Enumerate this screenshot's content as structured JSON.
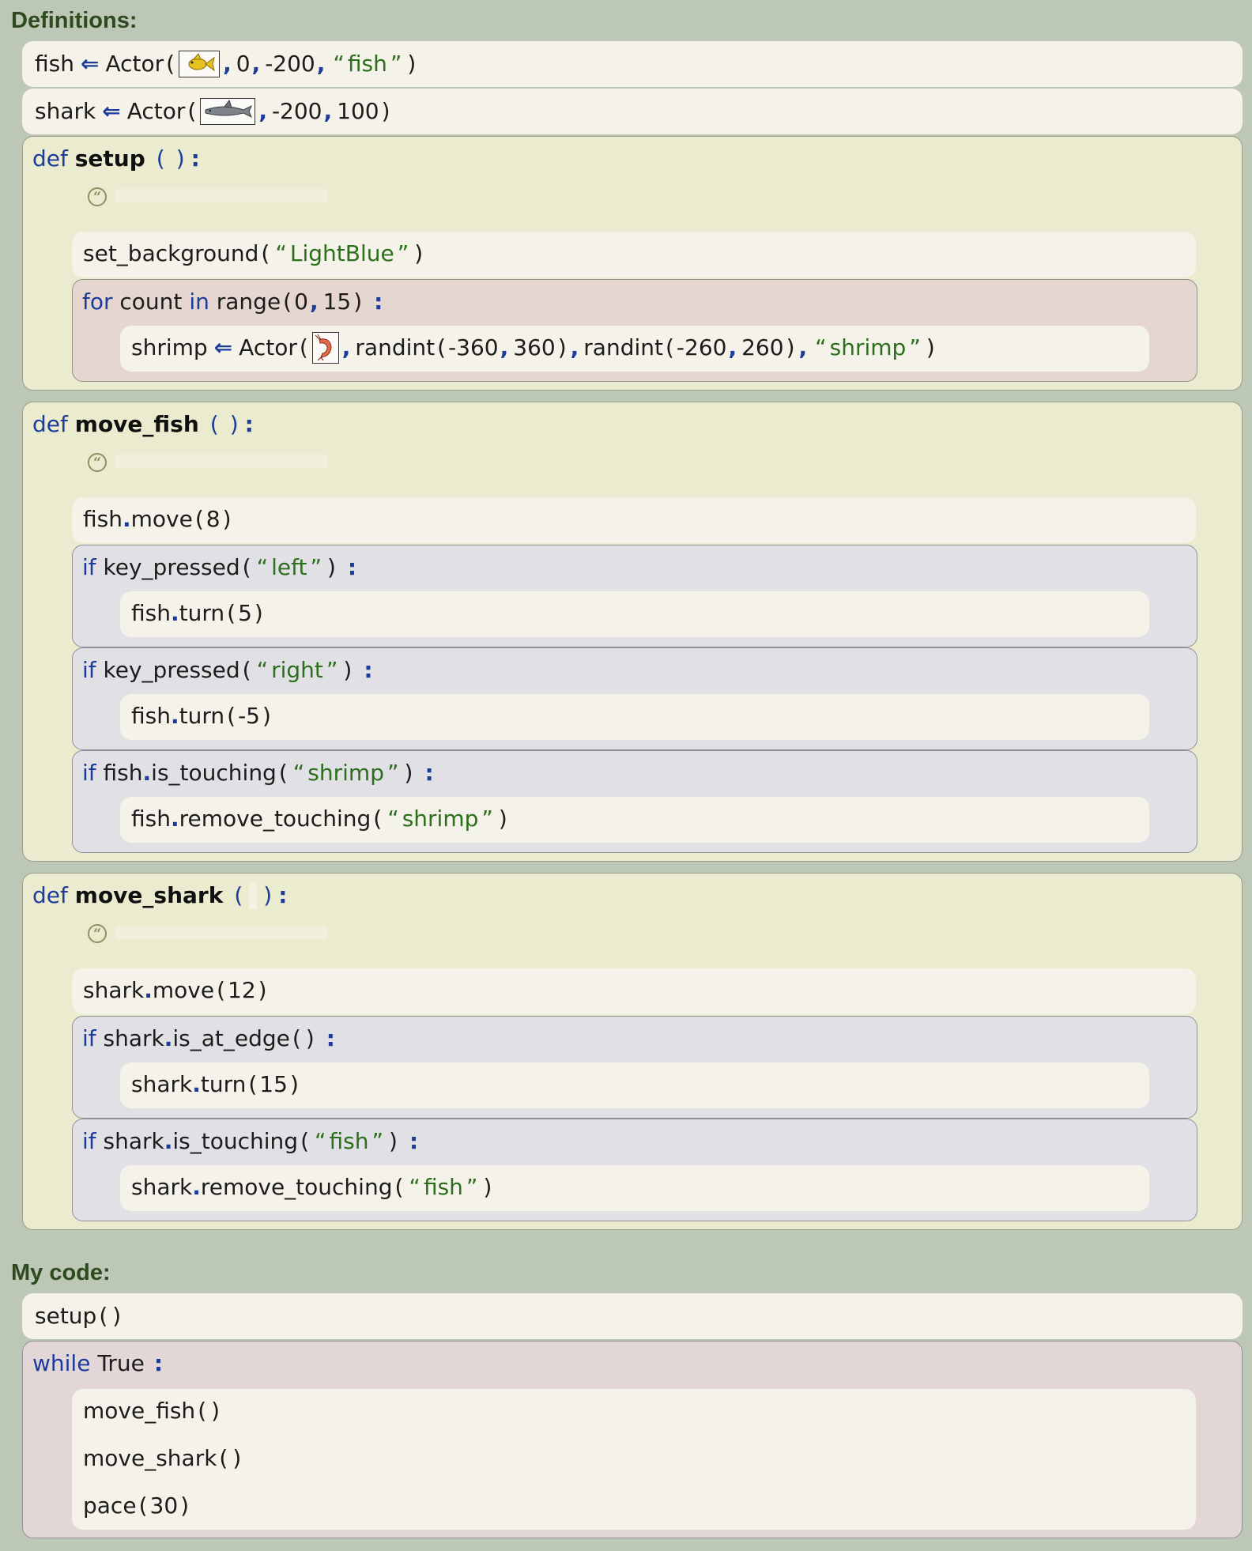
{
  "definitions_label": "Definitions:",
  "my_code_label": "My code:",
  "globals": {
    "fish": {
      "var": "fish",
      "func": "Actor",
      "args": [
        "0",
        "-200"
      ],
      "name": "fish",
      "image_icon": "goldfish-image-icon"
    },
    "shark": {
      "var": "shark",
      "func": "Actor",
      "args": [
        "-200",
        "100"
      ],
      "image_icon": "shark-image-icon"
    }
  },
  "keywords": {
    "def": "def",
    "for": "for",
    "in": "in",
    "if": "if",
    "while": "while"
  },
  "setup": {
    "name": "setup",
    "bg_func": "set_background",
    "bg_color": "LightBlue",
    "loop_var": "count",
    "range_func": "range",
    "range_args": [
      "0",
      "15"
    ],
    "shrimp_var": "shrimp",
    "shrimp_func": "Actor",
    "randint": "randint",
    "randx": [
      "-360",
      "360"
    ],
    "randy": [
      "-260",
      "260"
    ],
    "shrimp_name": "shrimp",
    "image_icon": "shrimp-image-icon"
  },
  "move_fish": {
    "name": "move_fish",
    "obj": "fish",
    "move": "move",
    "move_arg": "8",
    "key_pressed": "key_pressed",
    "left": "left",
    "right": "right",
    "turn": "turn",
    "turn_left": "5",
    "turn_right": "-5",
    "is_touching": "is_touching",
    "touch_target": "shrimp",
    "remove_touching": "remove_touching"
  },
  "move_shark": {
    "name": "move_shark",
    "obj": "shark",
    "move": "move",
    "move_arg": "12",
    "is_at_edge": "is_at_edge",
    "turn": "turn",
    "turn_arg": "15",
    "is_touching": "is_touching",
    "touch_target": "fish",
    "remove_touching": "remove_touching"
  },
  "main": {
    "setup_call": "setup",
    "while_cond": "True",
    "calls": [
      "move_fish",
      "move_shark"
    ],
    "pace": "pace",
    "pace_arg": "30"
  },
  "colors": {
    "background": "#bcc7b6",
    "def_block": "#ebebd0",
    "for_block": "#e5d7cf",
    "if_block": "#e1e0e5",
    "while_block": "#e2d6d7",
    "statement": "#f5f2ea",
    "keyword": "#1d3b9a",
    "string": "#2b6e1c"
  }
}
